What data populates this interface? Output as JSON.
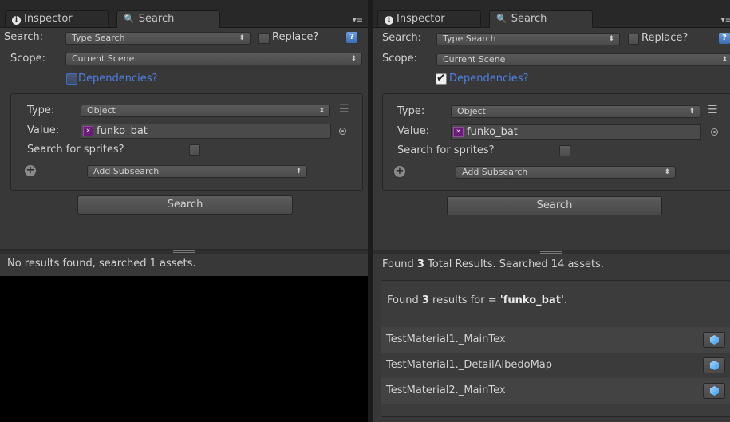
{
  "panels": [
    {
      "tabs": {
        "inspector": "Inspector",
        "search": "Search"
      },
      "search_label": "Search:",
      "search_type": "Type Search",
      "replace_label": "Replace?",
      "replace_checked": false,
      "scope_label": "Scope:",
      "scope_value": "Current Scene",
      "dependencies_label": "Dependencies?",
      "dependencies_checked": false,
      "type_label": "Type:",
      "type_value": "Object",
      "value_label": "Value:",
      "value_text": "funko_bat",
      "sprites_label": "Search for sprites?",
      "sprites_checked": false,
      "add_subsearch": "Add Subsearch",
      "search_button": "Search",
      "status": "No results found, searched 1 assets."
    },
    {
      "tabs": {
        "inspector": "Inspector",
        "search": "Search"
      },
      "search_label": "Search:",
      "search_type": "Type Search",
      "replace_label": "Replace?",
      "replace_checked": false,
      "scope_label": "Scope:",
      "scope_value": "Current Scene",
      "dependencies_label": "Dependencies?",
      "dependencies_checked": true,
      "type_label": "Type:",
      "type_value": "Object",
      "value_label": "Value:",
      "value_text": "funko_bat",
      "sprites_label": "Search for sprites?",
      "sprites_checked": false,
      "add_subsearch": "Add Subsearch",
      "search_button": "Search",
      "status": {
        "prefix": "Found",
        "count": "3",
        "suffix": "Total Results. Searched 14 assets."
      },
      "results_header": {
        "prefix": "Found",
        "count": "3",
        "middle": "results for  =",
        "query": "'funko_bat'",
        "end": "."
      },
      "results": [
        "TestMaterial1._MainTex",
        "TestMaterial1._DetailAlbedoMap",
        "TestMaterial2._MainTex"
      ]
    }
  ],
  "colors": {
    "panel_bg": "#383838",
    "link_blue": "#4f7fe6",
    "material_icon": "#6a1a78",
    "cube_icon": "#3a9ff0"
  },
  "icons": {
    "inspector_tab": "info-icon",
    "search_tab": "magnifier-icon",
    "tab_menu": "menu-icon",
    "help": "help-icon",
    "material": "material-icon",
    "picker": "object-picker-icon",
    "list_menu": "hamburger-icon",
    "add": "plus-icon",
    "result_action": "cube-icon"
  }
}
